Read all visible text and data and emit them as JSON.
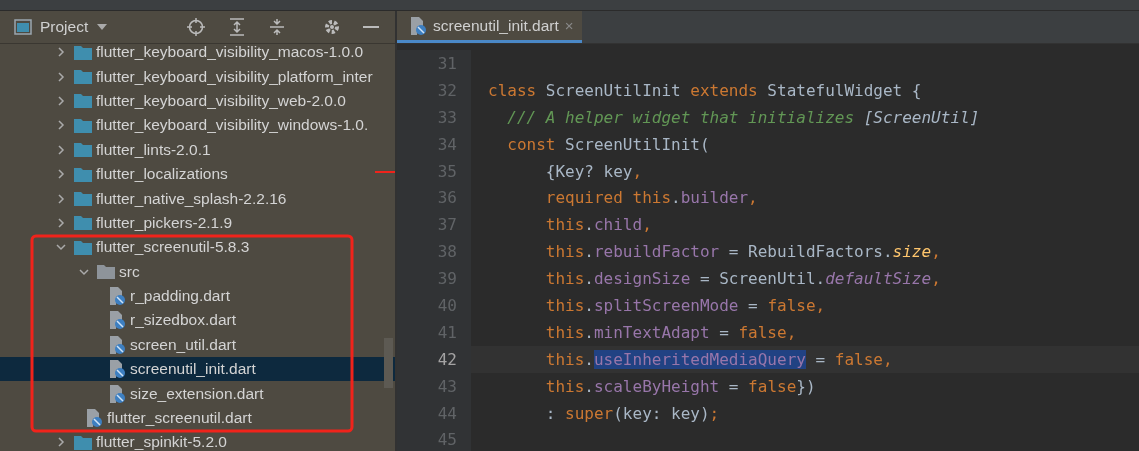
{
  "project_panel": {
    "title": "Project"
  },
  "tree": [
    {
      "label": "flutter_keyboard_visibility_macos-1.0.0",
      "kind": "folder",
      "expanded": false,
      "selected": false
    },
    {
      "label": "flutter_keyboard_visibility_platform_inter",
      "kind": "folder",
      "expanded": false,
      "selected": false
    },
    {
      "label": "flutter_keyboard_visibility_web-2.0.0",
      "kind": "folder",
      "expanded": false,
      "selected": false
    },
    {
      "label": "flutter_keyboard_visibility_windows-1.0.",
      "kind": "folder",
      "expanded": false,
      "selected": false
    },
    {
      "label": "flutter_lints-2.0.1",
      "kind": "folder",
      "expanded": false,
      "selected": false
    },
    {
      "label": "flutter_localizations",
      "kind": "folder",
      "expanded": false,
      "selected": false
    },
    {
      "label": "flutter_native_splash-2.2.16",
      "kind": "folder",
      "expanded": false,
      "selected": false
    },
    {
      "label": "flutter_pickers-2.1.9",
      "kind": "folder",
      "expanded": false,
      "selected": false
    },
    {
      "label": "flutter_screenutil-5.8.3",
      "kind": "folder",
      "expanded": true,
      "selected": false,
      "children": [
        {
          "label": "src",
          "kind": "dir",
          "expanded": true,
          "selected": false,
          "children": [
            {
              "label": "r_padding.dart",
              "kind": "file",
              "selected": false
            },
            {
              "label": "r_sizedbox.dart",
              "kind": "file",
              "selected": false
            },
            {
              "label": "screen_util.dart",
              "kind": "file",
              "selected": false
            },
            {
              "label": "screenutil_init.dart",
              "kind": "file",
              "selected": true
            },
            {
              "label": "size_extension.dart",
              "kind": "file",
              "selected": false
            }
          ]
        },
        {
          "label": "flutter_screenutil.dart",
          "kind": "file",
          "selected": false
        }
      ]
    },
    {
      "label": "flutter_spinkit-5.2.0",
      "kind": "folder",
      "expanded": false,
      "selected": false
    }
  ],
  "tabs": [
    {
      "label": "screenutil_init.dart",
      "close": "×",
      "selected": true
    }
  ],
  "code_lines": [
    {
      "number": "31",
      "current": false
    },
    {
      "number": "32",
      "current": false,
      "tokens": [
        {
          "kind": "kw",
          "text": "class "
        },
        {
          "kind": "plain",
          "text": "ScreenUtilInit "
        },
        {
          "kind": "kw",
          "text": "extends "
        },
        {
          "kind": "plain",
          "text": "StatefulWidget {"
        }
      ]
    },
    {
      "number": "33",
      "current": false,
      "tokens": [
        {
          "kind": "comment",
          "text": "  /// A helper widget that initializes "
        },
        {
          "kind": "comment-ref",
          "text": "[ScreenUtil]"
        }
      ]
    },
    {
      "number": "34",
      "current": false,
      "tokens": [
        {
          "kind": "kw",
          "text": "  const "
        },
        {
          "kind": "plain",
          "text": "ScreenUtilInit("
        }
      ]
    },
    {
      "number": "35",
      "current": false,
      "tokens": [
        {
          "kind": "plain",
          "text": "      {Key? key"
        },
        {
          "kind": "kw",
          "text": ","
        }
      ]
    },
    {
      "number": "36",
      "current": false,
      "tokens": [
        {
          "kind": "kw",
          "text": "      required this"
        },
        {
          "kind": "plain",
          "text": "."
        },
        {
          "kind": "field",
          "text": "builder"
        },
        {
          "kind": "kw",
          "text": ","
        }
      ]
    },
    {
      "number": "37",
      "current": false,
      "tokens": [
        {
          "kind": "kw",
          "text": "      this"
        },
        {
          "kind": "plain",
          "text": "."
        },
        {
          "kind": "field",
          "text": "child"
        },
        {
          "kind": "kw",
          "text": ","
        }
      ]
    },
    {
      "number": "38",
      "current": false,
      "tokens": [
        {
          "kind": "kw",
          "text": "      this"
        },
        {
          "kind": "plain",
          "text": "."
        },
        {
          "kind": "field",
          "text": "rebuildFactor"
        },
        {
          "kind": "plain",
          "text": " = RebuildFactors."
        },
        {
          "kind": "enum",
          "text": "size"
        },
        {
          "kind": "kw",
          "text": ","
        }
      ]
    },
    {
      "number": "39",
      "current": false,
      "tokens": [
        {
          "kind": "kw",
          "text": "      this"
        },
        {
          "kind": "plain",
          "text": "."
        },
        {
          "kind": "field",
          "text": "designSize"
        },
        {
          "kind": "plain",
          "text": " = ScreenUtil."
        },
        {
          "kind": "static",
          "text": "defaultSize"
        },
        {
          "kind": "kw",
          "text": ","
        }
      ]
    },
    {
      "number": "40",
      "current": false,
      "tokens": [
        {
          "kind": "kw",
          "text": "      this"
        },
        {
          "kind": "plain",
          "text": "."
        },
        {
          "kind": "field",
          "text": "splitScreenMode"
        },
        {
          "kind": "plain",
          "text": " = "
        },
        {
          "kind": "kw",
          "text": "false,"
        }
      ]
    },
    {
      "number": "41",
      "current": false,
      "tokens": [
        {
          "kind": "kw",
          "text": "      this"
        },
        {
          "kind": "plain",
          "text": "."
        },
        {
          "kind": "field",
          "text": "minTextAdapt"
        },
        {
          "kind": "plain",
          "text": " = "
        },
        {
          "kind": "kw",
          "text": "false,"
        }
      ]
    },
    {
      "number": "42",
      "current": true,
      "tokens": [
        {
          "kind": "kw",
          "text": "      this"
        },
        {
          "kind": "plain",
          "text": "."
        },
        {
          "kind": "field-selected",
          "text": "useInheritedMediaQuery"
        },
        {
          "kind": "plain",
          "text": " = "
        },
        {
          "kind": "kw",
          "text": "false,"
        }
      ]
    },
    {
      "number": "43",
      "current": false,
      "tokens": [
        {
          "kind": "kw",
          "text": "      this"
        },
        {
          "kind": "plain",
          "text": "."
        },
        {
          "kind": "field",
          "text": "scaleByHeight"
        },
        {
          "kind": "plain",
          "text": " = "
        },
        {
          "kind": "kw",
          "text": "false"
        },
        {
          "kind": "plain",
          "text": "})"
        }
      ]
    },
    {
      "number": "44",
      "current": false,
      "tokens": [
        {
          "kind": "plain",
          "text": "      : "
        },
        {
          "kind": "kw",
          "text": "super"
        },
        {
          "kind": "plain",
          "text": "(key: key)"
        },
        {
          "kind": "kw",
          "text": ";"
        }
      ]
    },
    {
      "number": "45",
      "current": false
    }
  ]
}
